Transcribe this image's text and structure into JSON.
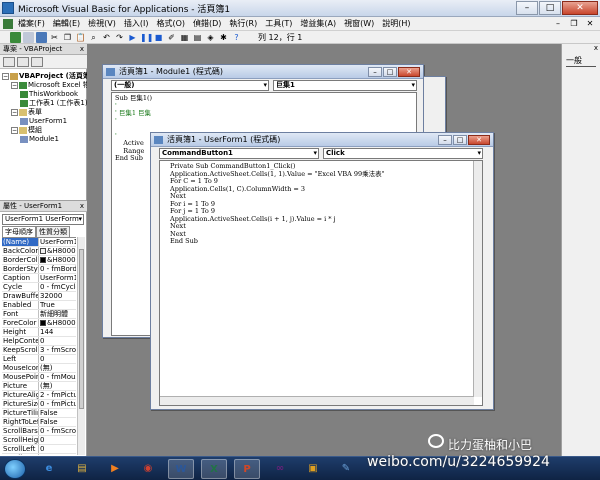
{
  "app": {
    "title": "Microsoft Visual Basic for Applications - 活頁簿1"
  },
  "menubar": {
    "items": [
      "檔案(F)",
      "編輯(E)",
      "檢視(V)",
      "插入(I)",
      "格式(O)",
      "偵錯(D)",
      "執行(R)",
      "工具(T)",
      "增益集(A)",
      "視窗(W)",
      "說明(H)"
    ]
  },
  "toolbar": {
    "position": "列 12，行 1"
  },
  "project": {
    "title": "專案 - VBAProject",
    "close": "x",
    "tree": [
      {
        "label": "VBAProject (活頁簿1)",
        "level": 0,
        "bold": true
      },
      {
        "label": "Microsoft Excel 物件",
        "level": 1
      },
      {
        "label": "ThisWorkbook",
        "level": 2
      },
      {
        "label": "工作表1 (工作表1)",
        "level": 2
      },
      {
        "label": "表單",
        "level": 1
      },
      {
        "label": "UserForm1",
        "level": 2
      },
      {
        "label": "模組",
        "level": 1
      },
      {
        "label": "Module1",
        "level": 2
      }
    ]
  },
  "properties": {
    "title": "屬性 - UserForm1",
    "object": "UserForm1 UserForm",
    "tabs": [
      "字母順序",
      "性質分類"
    ],
    "rows": [
      [
        "(Name)",
        "UserForm1"
      ],
      [
        "BackColor",
        "&H8000"
      ],
      [
        "BorderColor",
        "&H8000"
      ],
      [
        "BorderStyle",
        "0 - fmBorde"
      ],
      [
        "Caption",
        "UserForm1"
      ],
      [
        "Cycle",
        "0 - fmCycle"
      ],
      [
        "DrawBuffer",
        "32000"
      ],
      [
        "Enabled",
        "True"
      ],
      [
        "Font",
        "新細明體"
      ],
      [
        "ForeColor",
        "&H8000"
      ],
      [
        "Height",
        "144"
      ],
      [
        "HelpContextID",
        "0"
      ],
      [
        "KeepScrollBa",
        "3 - fmScrol"
      ],
      [
        "Left",
        "0"
      ],
      [
        "MouseIcon",
        "(無)"
      ],
      [
        "MousePointer",
        "0 - fmMous"
      ],
      [
        "Picture",
        "(無)"
      ],
      [
        "PictureAlign",
        "2 - fmPictu"
      ],
      [
        "PictureSizeM",
        "0 - fmPictu"
      ],
      [
        "PictureTiling",
        "False"
      ],
      [
        "RightToLeft",
        "False"
      ],
      [
        "ScrollBars",
        "0 - fmScrol"
      ],
      [
        "ScrollHeight",
        "0"
      ],
      [
        "ScrollLeft",
        "0"
      ],
      [
        "ScrollTop",
        "0"
      ]
    ]
  },
  "right_panel": {
    "label": "一般",
    "close": "x"
  },
  "module_window": {
    "title": "活頁簿1 - Module1 (程式碼)",
    "combo_left": "(一般)",
    "combo_right": "巨集1",
    "code": [
      "Sub 巨集1()",
      "'",
      "' 巨集1 巨集",
      "'",
      "",
      "'",
      "    Active",
      "    Range",
      "End Sub"
    ]
  },
  "userform_window": {
    "title": "活頁簿1 - UserForm1 (程式碼)",
    "combo_left": "CommandButton1",
    "combo_right": "Click",
    "code": [
      "Private Sub CommandButton1_Click()",
      "Application.ActiveSheet.Cells(1, 1).Value = \"Excel VBA 99乘法表\"",
      "For C = 1 To 9",
      "Application.Cells(1, C).ColumnWidth = 3",
      "Next",
      "For i = 1 To 9",
      "For j = 1 To 9",
      "Application.ActiveSheet.Cells(i + 1, j).Value = i * j",
      "Next",
      "Next",
      "End Sub"
    ]
  },
  "watermark": {
    "line1": "比力蛋柚和小巴",
    "line2": "weibo.com/u/3224659924"
  },
  "taskbar": {
    "apps": [
      {
        "icon": "ie-icon",
        "color": "#3c8de0",
        "glyph": "e"
      },
      {
        "icon": "folder-icon",
        "color": "#e0b440",
        "glyph": "▤"
      },
      {
        "icon": "media-icon",
        "color": "#f08020",
        "glyph": "▶"
      },
      {
        "icon": "chrome-icon",
        "color": "#d04030",
        "glyph": "◉"
      },
      {
        "icon": "word-icon",
        "color": "#2b579a",
        "glyph": "W"
      },
      {
        "icon": "excel-icon",
        "color": "#217346",
        "glyph": "X"
      },
      {
        "icon": "powerpoint-icon",
        "color": "#d24726",
        "glyph": "P"
      },
      {
        "icon": "vs-icon",
        "color": "#68217a",
        "glyph": "∞"
      },
      {
        "icon": "chat-icon",
        "color": "#e0a020",
        "glyph": "▣"
      },
      {
        "icon": "paint-icon",
        "color": "#6aa0d8",
        "glyph": "✎"
      }
    ]
  }
}
